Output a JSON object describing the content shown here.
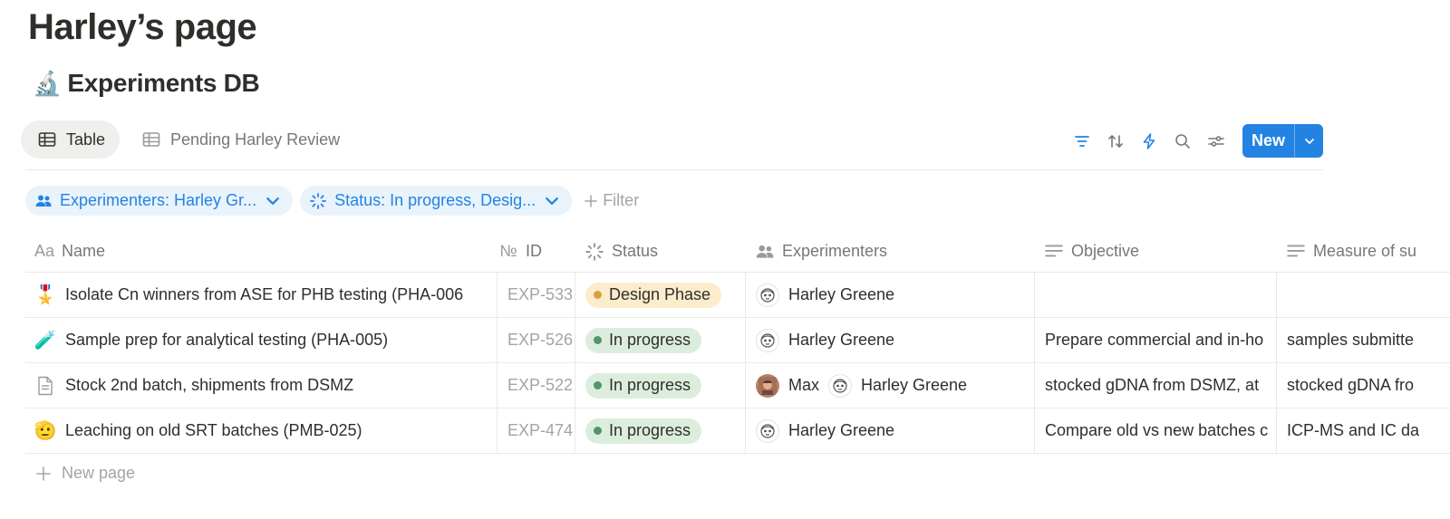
{
  "page": {
    "title": "Harley’s page"
  },
  "database": {
    "emoji": "🔬",
    "title": "Experiments DB"
  },
  "views": [
    {
      "label": "Table",
      "active": true
    },
    {
      "label": "Pending Harley Review",
      "active": false
    }
  ],
  "toolbar": {
    "icons": [
      "filter-icon",
      "sort-icon",
      "automation-icon",
      "search-icon",
      "settings-icon"
    ],
    "new_label": "New"
  },
  "filters": {
    "chips": [
      {
        "label": "Experimenters: Harley Gr...",
        "icon": "people-icon"
      },
      {
        "label": "Status: In progress, Desig...",
        "icon": "status-icon"
      }
    ],
    "add_label": "Filter"
  },
  "table": {
    "columns": [
      {
        "label": "Name",
        "icon": "Aa"
      },
      {
        "label": "ID",
        "icon": "№"
      },
      {
        "label": "Status",
        "icon": "status-icon"
      },
      {
        "label": "Experimenters",
        "icon": "people-icon"
      },
      {
        "label": "Objective",
        "icon": "text-icon"
      },
      {
        "label": "Measure of su",
        "icon": "text-icon"
      }
    ],
    "rows": [
      {
        "icon": "🎖️",
        "name": "Isolate Cn winners from ASE for PHB testing (PHA-006",
        "id": "EXP-533",
        "status": "Design Phase",
        "experimenters": [
          "Harley Greene"
        ],
        "objective": "",
        "measure": ""
      },
      {
        "icon": "🧪",
        "name": "Sample prep for analytical testing (PHA-005)",
        "id": "EXP-526",
        "status": "In progress",
        "experimenters": [
          "Harley Greene"
        ],
        "objective": "Prepare commercial and in-ho",
        "measure": "samples submitte"
      },
      {
        "icon": "page-icon",
        "name": "Stock 2nd batch, shipments from DSMZ",
        "id": "EXP-522",
        "status": "In progress",
        "experimenters": [
          "Max",
          "Harley Greene"
        ],
        "objective": "stocked gDNA from DSMZ, at",
        "measure": "stocked gDNA fro"
      },
      {
        "icon": "🫡",
        "name": "Leaching on old SRT batches (PMB-025)",
        "id": "EXP-474",
        "status": "In progress",
        "experimenters": [
          "Harley Greene"
        ],
        "objective": "Compare old vs new batches c",
        "measure": "ICP-MS and IC da"
      }
    ],
    "new_page_label": "New page"
  },
  "colors": {
    "accent": "#2383e2",
    "design_phase_bg": "#fbeccc",
    "design_phase_dot": "#d9a23c",
    "in_progress_bg": "#dcedde",
    "in_progress_dot": "#4f9768"
  }
}
